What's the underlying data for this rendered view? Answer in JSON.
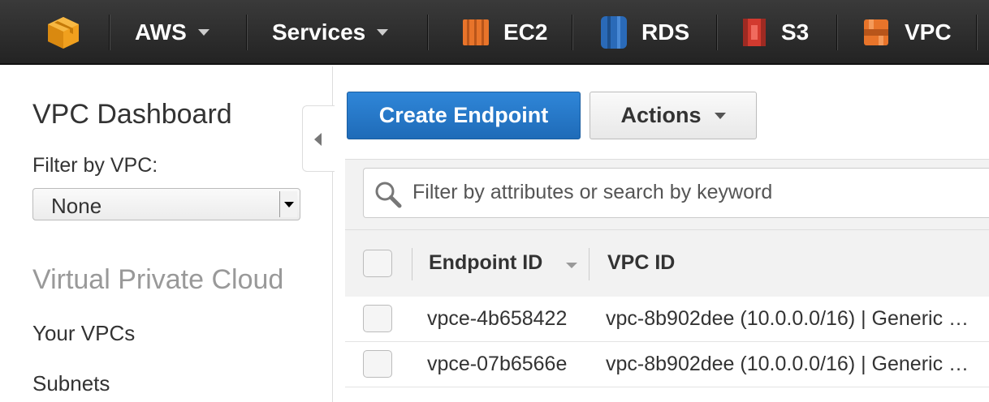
{
  "topnav": {
    "items": [
      {
        "label": "AWS",
        "icon": "aws-cube-icon"
      },
      {
        "label": "Services"
      },
      {
        "label": "EC2",
        "icon": "ec2-icon"
      },
      {
        "label": "RDS",
        "icon": "rds-icon"
      },
      {
        "label": "S3",
        "icon": "s3-icon"
      },
      {
        "label": "VPC",
        "icon": "vpc-icon"
      }
    ]
  },
  "sidebar": {
    "title": "VPC Dashboard",
    "filter_label": "Filter by VPC:",
    "filter_value": "None",
    "section_title": "Virtual Private Cloud",
    "links": [
      "Your VPCs",
      "Subnets"
    ]
  },
  "toolbar": {
    "create_label": "Create Endpoint",
    "actions_label": "Actions"
  },
  "search": {
    "placeholder": "Filter by attributes or search by keyword"
  },
  "table": {
    "columns": [
      "Endpoint ID",
      "VPC ID"
    ],
    "rows": [
      {
        "endpoint_id": "vpce-4b658422",
        "vpc_id": "vpc-8b902dee (10.0.0.0/16) | Generic …"
      },
      {
        "endpoint_id": "vpce-07b6566e",
        "vpc_id": "vpc-8b902dee (10.0.0.0/16) | Generic …"
      }
    ]
  },
  "colors": {
    "primary": "#1f6bb8",
    "nav_bg": "#232323",
    "aws_orange": "#f0a01e",
    "ec2_orange": "#e8742a",
    "rds_blue": "#2a6ab8",
    "s3_red": "#d23a2f",
    "vpc_orange": "#e8742a"
  }
}
